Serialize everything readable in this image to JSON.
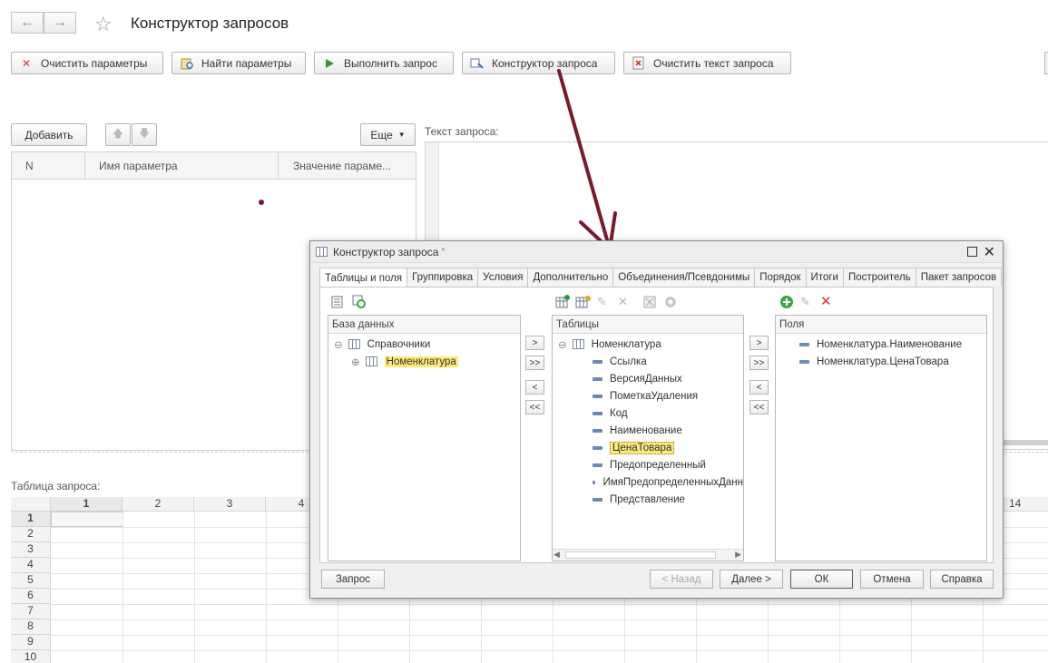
{
  "window": {
    "title": "Конструктор запросов"
  },
  "toolbar": {
    "clear_params": "Очистить параметры",
    "find_params": "Найти параметры",
    "run_query": "Выполнить запрос",
    "query_builder": "Конструктор запроса",
    "clear_query_text": "Очистить текст запроса"
  },
  "params": {
    "add_label": "Добавить",
    "more_label": "Еще",
    "columns": [
      "N",
      "Имя параметра",
      "Значение параме..."
    ]
  },
  "query_text_label": "Текст запроса:",
  "result_table": {
    "label": "Таблица запроса:",
    "columns": [
      "1",
      "2",
      "3",
      "4",
      "14"
    ],
    "rows": [
      "1",
      "2",
      "3",
      "4",
      "5",
      "6",
      "7",
      "8",
      "9",
      "10"
    ]
  },
  "dialog": {
    "title": "Конструктор запроса",
    "title_mark": "*",
    "tabs": [
      "Таблицы и поля",
      "Группировка",
      "Условия",
      "Дополнительно",
      "Объединения/Псевдонимы",
      "Порядок",
      "Итоги",
      "Построитель",
      "Пакет запросов"
    ],
    "database_panel": {
      "header": "База данных",
      "group": "Справочники",
      "item": "Номенклатура"
    },
    "tables_panel": {
      "header": "Таблицы",
      "table": "Номенклатура",
      "fields": [
        "Ссылка",
        "ВерсияДанных",
        "ПометкаУдаления",
        "Код",
        "Наименование",
        "ЦенаТовара",
        "Предопределенный",
        "ИмяПредопределенныхДанн",
        "Представление"
      ]
    },
    "fields_panel": {
      "header": "Поля",
      "fields": [
        "Номенклатура.Наименование",
        "Номенклатура.ЦенаТовара"
      ]
    },
    "move": {
      "right": ">",
      "all_right": ">>",
      "left": "<",
      "all_left": "<<"
    },
    "buttons": {
      "query": "Запрос",
      "back": "< Назад",
      "next": "Далее >",
      "ok": "ОК",
      "cancel": "Отмена",
      "help": "Справка"
    }
  },
  "colors": {
    "arrow": "#7b1a2c",
    "highlight": "#fce97a",
    "delete_red": "#d9342b"
  }
}
